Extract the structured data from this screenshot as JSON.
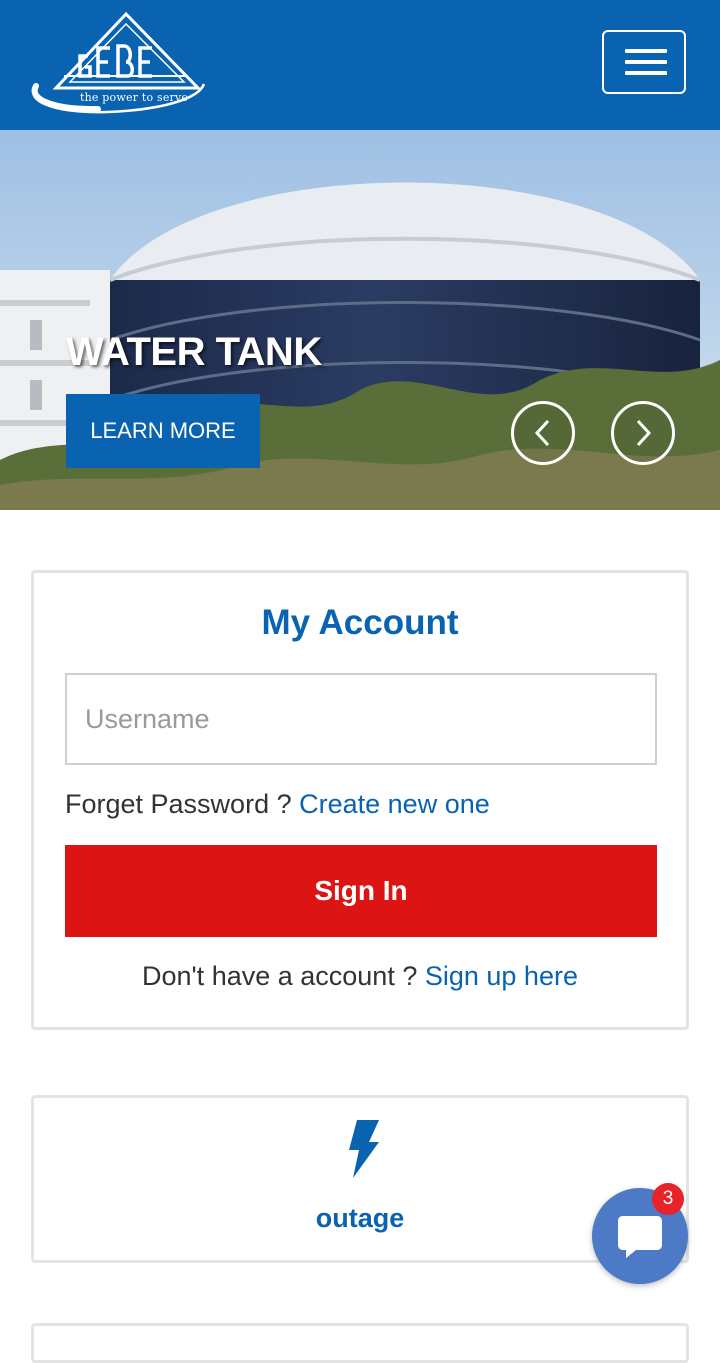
{
  "header": {
    "logo_text": "GEBE",
    "logo_tagline": "the power to serve",
    "menu_icon": "hamburger-icon"
  },
  "hero": {
    "title": "WATER TANK",
    "button_label": "LEARN MORE",
    "prev_icon": "chevron-left-icon",
    "next_icon": "chevron-right-icon"
  },
  "account": {
    "title": "My Account",
    "username_placeholder": "Username",
    "username_value": "",
    "forget_text": "Forget Password ?",
    "forget_link": "Create new one",
    "signin_label": "Sign In",
    "signup_text": "Don't have a account ?",
    "signup_link": "Sign up here"
  },
  "services": [
    {
      "label": "outage",
      "icon": "lightning-bolt-icon"
    }
  ],
  "chat": {
    "icon": "chat-bubble-icon",
    "badge_count": "3"
  },
  "colors": {
    "brand_blue": "#0a63b0",
    "signin_red": "#dc1414",
    "chat_blue": "#4c7ac7",
    "badge_red": "#e8232a"
  }
}
